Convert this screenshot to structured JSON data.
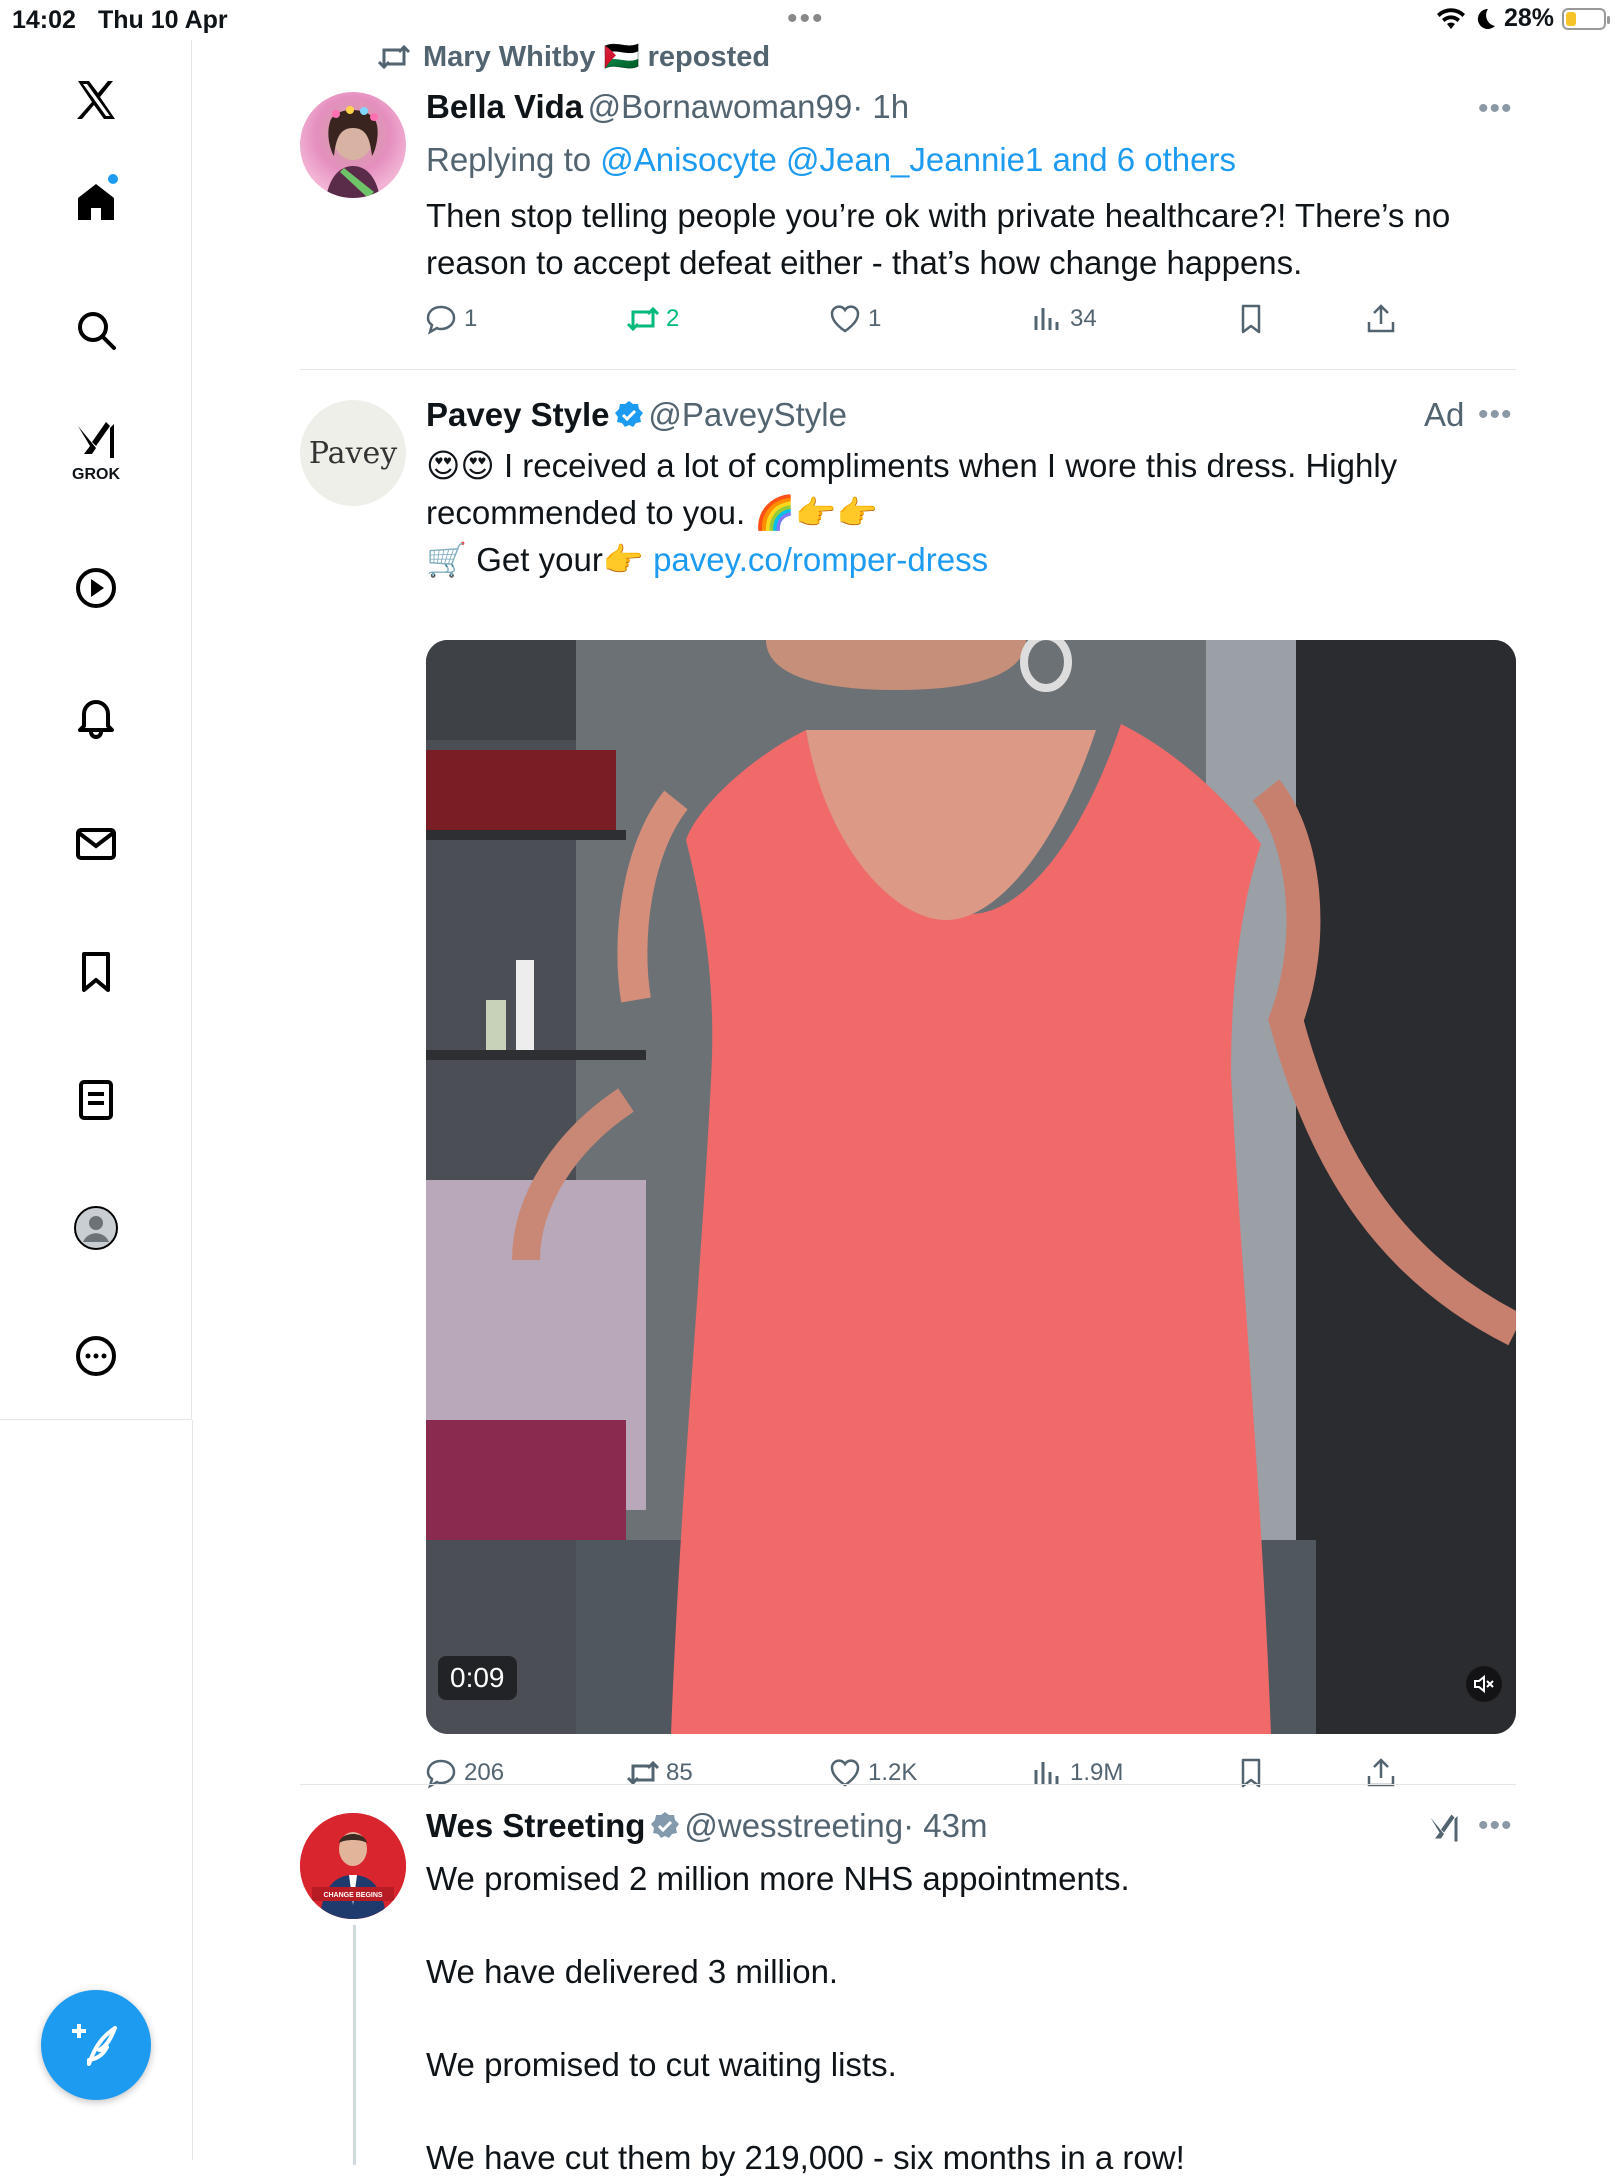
{
  "status": {
    "time": "14:02",
    "date": "Thu 10 Apr",
    "battery": "28%",
    "battery_level": 0.28
  },
  "sidebar": {
    "items": [
      {
        "name": "x-logo"
      },
      {
        "name": "home"
      },
      {
        "name": "search"
      },
      {
        "name": "grok",
        "label": "GROK"
      },
      {
        "name": "video"
      },
      {
        "name": "notifications"
      },
      {
        "name": "messages"
      },
      {
        "name": "bookmarks"
      },
      {
        "name": "lists"
      },
      {
        "name": "profile"
      },
      {
        "name": "more"
      }
    ]
  },
  "posts": [
    {
      "repost_by": "Mary Whitby 🇵🇸 reposted",
      "name": "Bella Vida",
      "handle": "@Bornawoman99",
      "time": "· 1h",
      "replying_prefix": "Replying to ",
      "replying_to": "@Anisocyte @Jean_Jeannie1 and 6 others",
      "text": "Then stop telling people you’re ok with private healthcare?! There’s no reason to accept defeat either - that’s how change happens.",
      "stats": {
        "replies": "1",
        "reposts": "2",
        "likes": "1",
        "views": "34"
      }
    },
    {
      "name": "Pavey Style",
      "handle": "@PaveyStyle",
      "ad_label": "Ad",
      "avatar_text": "Pavey",
      "text_line1": "😍😍 I received a lot of compliments when I wore this dress. Highly",
      "text_line2": "recommended to you. 🌈👉👉",
      "text_line3_prefix": "🛒 Get your👉 ",
      "link": "pavey.co/romper-dress",
      "video_time": "0:09",
      "stats": {
        "replies": "206",
        "reposts": "85",
        "likes": "1.2K",
        "views": "1.9M"
      }
    },
    {
      "name": "Wes Streeting",
      "handle": "@wesstreeting",
      "time": "· 43m",
      "lines": [
        "We promised 2 million more NHS appointments.",
        "We have delivered 3 million.",
        "We promised to cut waiting lists.",
        "We have cut them by 219,000 - six months in a row!"
      ]
    }
  ]
}
